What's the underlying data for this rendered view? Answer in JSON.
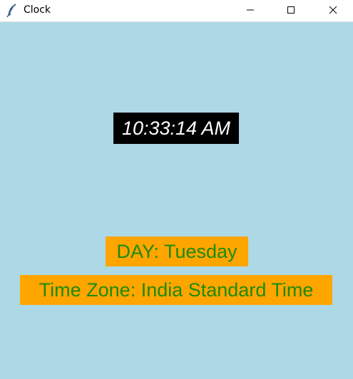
{
  "window": {
    "title": "Clock",
    "app_icon": "feather-icon"
  },
  "controls": {
    "minimize_icon": "minimize-icon",
    "maximize_icon": "maximize-icon",
    "close_icon": "close-icon"
  },
  "clock": {
    "time": "10:33:14 AM",
    "day": "DAY: Tuesday",
    "timezone": "Time Zone: India Standard Time"
  },
  "colors": {
    "background": "#add8e6",
    "time_bg": "#000000",
    "time_fg": "#ffffff",
    "label_bg": "#ffa500",
    "label_fg": "#1d8a0c"
  }
}
